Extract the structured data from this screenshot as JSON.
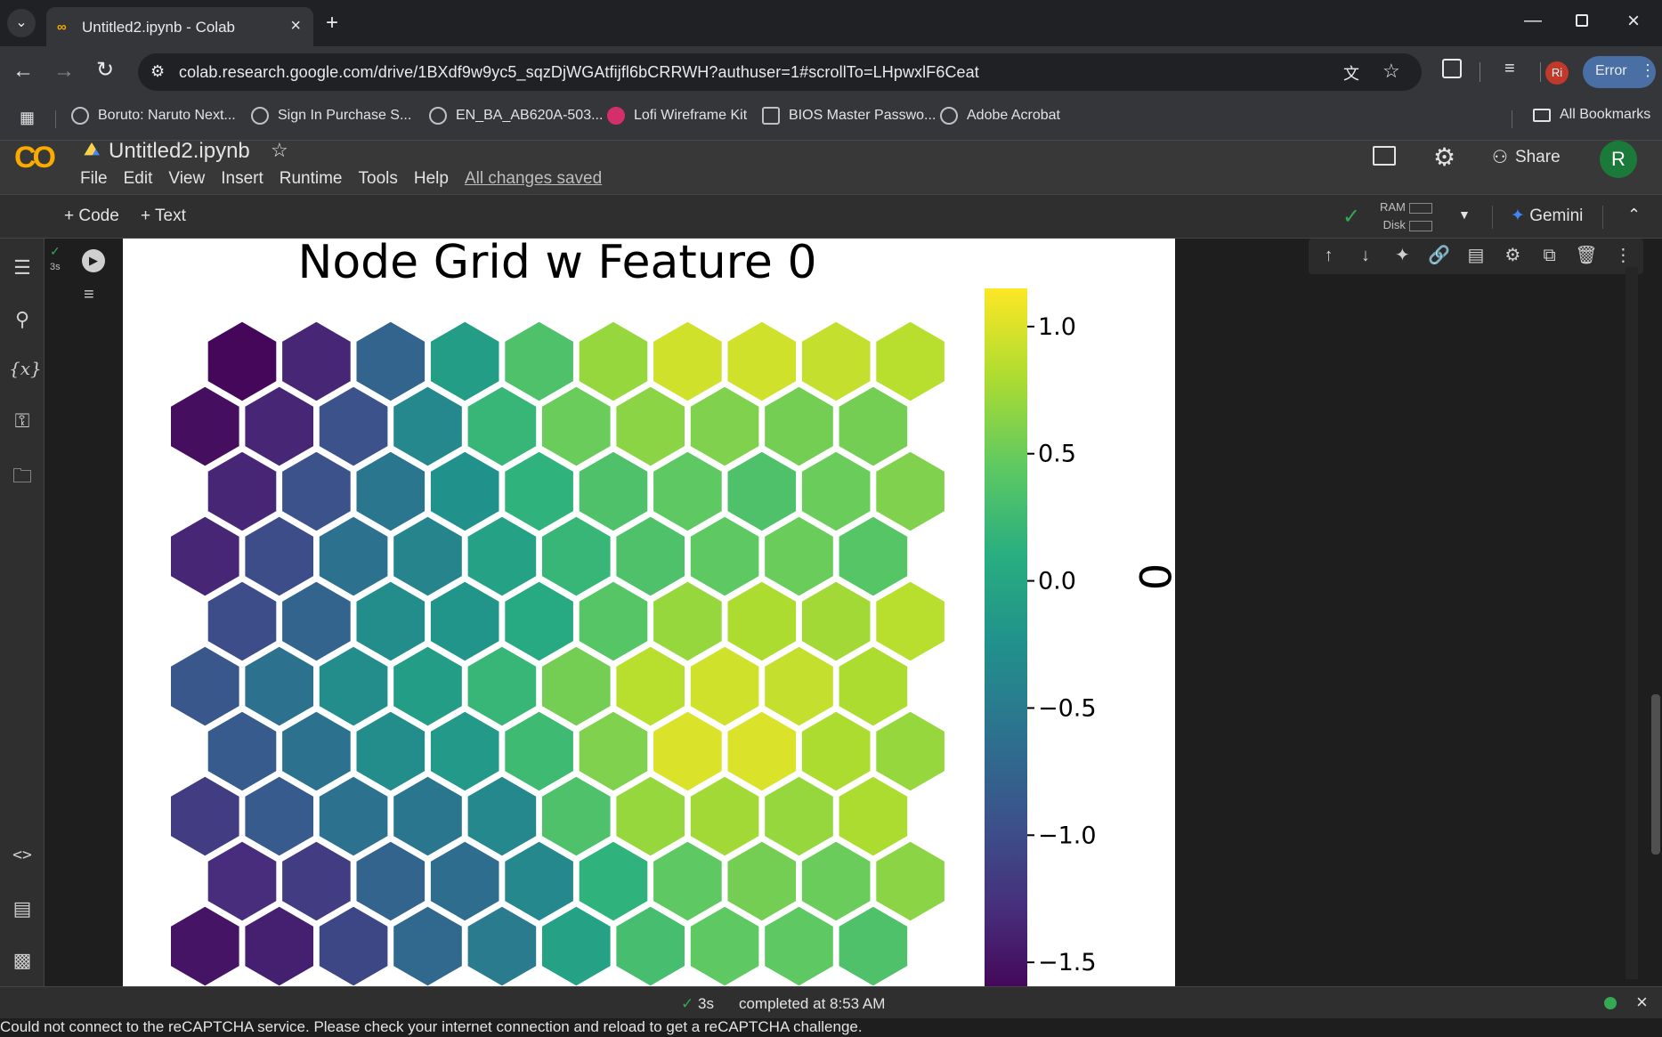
{
  "browser": {
    "tab_title": "Untitled2.ipynb - Colab",
    "url": "colab.research.google.com/drive/1BXdf9w9yc5_sqzDjWGAtfijfl6bCRRWH?authuser=1#scrollTo=LHpwxlF6Ceat",
    "profile_initials": "Ri",
    "error_label": "Error",
    "bookmarks": [
      "Boruto: Naruto Next...",
      "Sign In  Purchase  S...",
      "EN_BA_AB620A-503...",
      "Lofi Wireframe Kit",
      "BIOS Master Passwo...",
      "Adobe Acrobat"
    ],
    "all_bookmarks": "All Bookmarks"
  },
  "colab": {
    "logo_text": "CO",
    "notebook_title": "Untitled2.ipynb",
    "menu": [
      "File",
      "Edit",
      "View",
      "Insert",
      "Runtime",
      "Tools",
      "Help"
    ],
    "save_status": "All changes saved",
    "share_label": "Share",
    "avatar_initial": "R",
    "add_code": "+ Code",
    "add_text": "+ Text",
    "ram_label": "RAM",
    "disk_label": "Disk",
    "gemini_label": "Gemini",
    "cell_exec_time": "3s"
  },
  "status": {
    "time": "3s",
    "message": "completed at 8:53 AM"
  },
  "warning_text": "Could not connect to the reCAPTCHA service. Please check your internet connection and reload to get a reCAPTCHA challenge.",
  "chart_data": {
    "type": "heatmap",
    "title": "Node Grid w Feature 0",
    "colorbar_label": "0",
    "colormap": "viridis",
    "clim": [
      -1.65,
      1.15
    ],
    "colorbar_ticks": [
      "1.0",
      "0.5",
      "0.0",
      "−0.5",
      "−1.0",
      "−1.5"
    ],
    "colorbar_tick_values": [
      1.0,
      0.5,
      0.0,
      -0.5,
      -1.0,
      -1.5
    ],
    "grid": "hexagonal",
    "rows_visible_top_to_bottom": [
      [
        -1.6,
        -1.35,
        -0.75,
        -0.1,
        0.35,
        0.7,
        0.95,
        0.95,
        0.9,
        0.85
      ],
      [
        -1.55,
        -1.35,
        -0.95,
        -0.35,
        0.2,
        0.5,
        0.65,
        0.6,
        0.55,
        0.55
      ],
      [
        -1.35,
        -0.95,
        -0.55,
        -0.25,
        0.15,
        0.35,
        0.45,
        0.35,
        0.5,
        0.6
      ],
      [
        -1.35,
        -1.0,
        -0.6,
        -0.4,
        -0.05,
        0.2,
        0.35,
        0.45,
        0.5,
        0.4
      ],
      [
        -1.0,
        -0.75,
        -0.3,
        -0.2,
        0.05,
        0.4,
        0.7,
        0.8,
        0.75,
        0.85
      ],
      [
        -0.9,
        -0.6,
        -0.3,
        -0.1,
        0.2,
        0.55,
        0.85,
        0.95,
        0.9,
        0.8
      ],
      [
        -0.85,
        -0.6,
        -0.3,
        -0.15,
        0.25,
        0.6,
        1.0,
        1.0,
        0.8,
        0.7
      ],
      [
        -1.15,
        -0.85,
        -0.6,
        -0.55,
        -0.35,
        0.35,
        0.7,
        0.75,
        0.7,
        0.8
      ],
      [
        -1.3,
        -1.15,
        -0.75,
        -0.65,
        -0.35,
        0.15,
        0.45,
        0.55,
        0.5,
        0.65
      ],
      [
        -1.5,
        -1.4,
        -1.05,
        -0.7,
        -0.5,
        -0.05,
        0.3,
        0.45,
        0.45,
        0.35
      ]
    ]
  }
}
